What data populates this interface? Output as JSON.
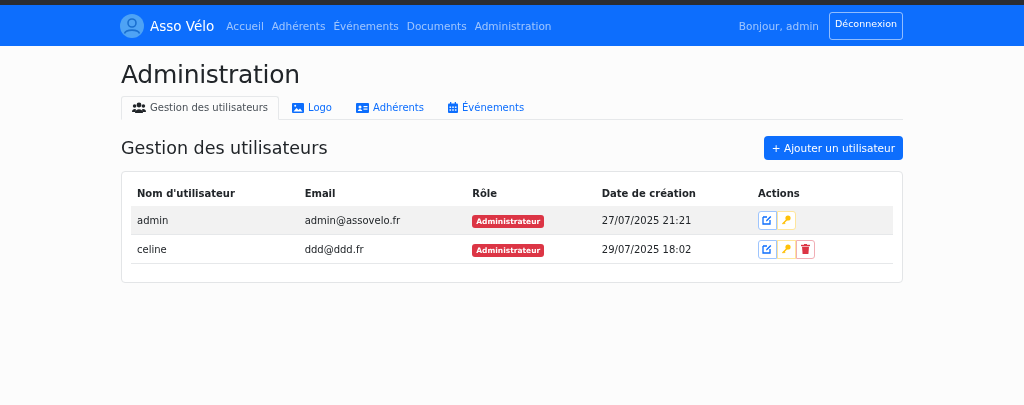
{
  "navbar": {
    "brand": "Asso Vélo",
    "links": [
      "Accueil",
      "Adhérents",
      "Événements",
      "Documents",
      "Administration"
    ],
    "greeting": "Bonjour, admin",
    "logout": "Déconnexion"
  },
  "page_title": "Administration",
  "tabs": [
    {
      "label": "Gestion des utilisateurs",
      "kind": "users",
      "selected": true
    },
    {
      "label": "Logo",
      "kind": "image",
      "selected": false
    },
    {
      "label": "Adhérents",
      "kind": "card",
      "selected": false
    },
    {
      "label": "Événements",
      "kind": "calendar",
      "selected": false
    }
  ],
  "section": {
    "title": "Gestion des utilisateurs",
    "add_button": "+ Ajouter un utilisateur"
  },
  "table": {
    "columns": [
      "Nom d'utilisateur",
      "Email",
      "Rôle",
      "Date de création",
      "Actions"
    ],
    "rows": [
      {
        "username": "admin",
        "email": "admin@assovelo.fr",
        "role": "Administrateur",
        "created": "27/07/2025 21:21",
        "highlighted": true,
        "actions": [
          {
            "kind": "edit"
          },
          {
            "kind": "key"
          }
        ]
      },
      {
        "username": "celine",
        "email": "ddd@ddd.fr",
        "role": "Administrateur",
        "created": "29/07/2025 18:02",
        "highlighted": false,
        "actions": [
          {
            "kind": "edit"
          },
          {
            "kind": "key"
          },
          {
            "kind": "delete"
          }
        ]
      }
    ]
  }
}
